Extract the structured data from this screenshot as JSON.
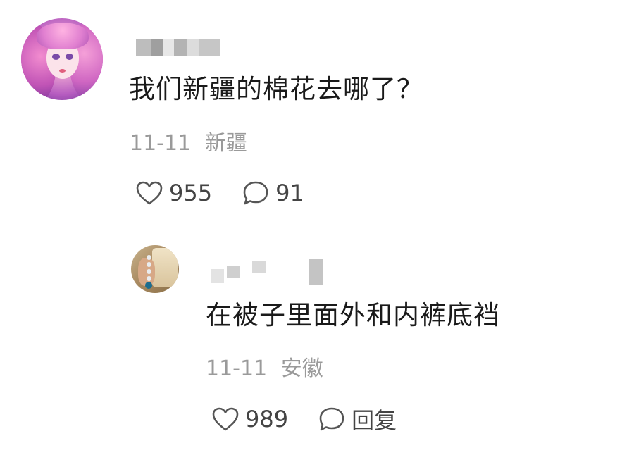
{
  "comment": {
    "avatar": "pink-haired-anime-girl-avatar",
    "username_redacted": true,
    "text": "我们新疆的棉花去哪了？",
    "date": "11-11",
    "location": "新疆",
    "likes": "955",
    "replies": "91",
    "like_icon": "heart-outline-icon",
    "reply_icon": "speech-bubble-icon"
  },
  "reply": {
    "avatar": "hand-with-bead-bracelet-avatar",
    "username_redacted": true,
    "text": "在被子里面外和内裤底裆",
    "date": "11-11",
    "location": "安徽",
    "likes": "989",
    "reply_label": "回复",
    "like_icon": "heart-outline-icon",
    "reply_icon": "speech-bubble-icon"
  },
  "colors": {
    "text": "#1a1a1a",
    "meta": "#9a9a9a",
    "action": "#444444"
  }
}
